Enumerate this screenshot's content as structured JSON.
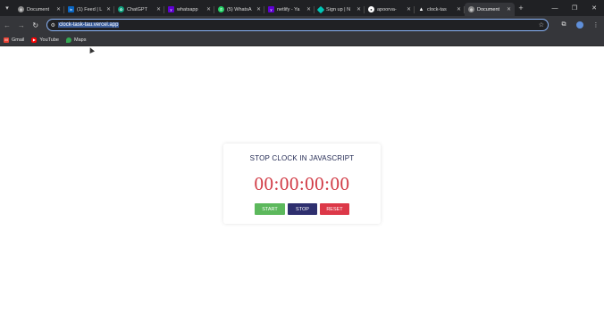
{
  "browser": {
    "tabs": [
      {
        "title": "Document",
        "icon": "globe-icon",
        "color": "#8a8a8a"
      },
      {
        "title": "(1) Feed | L",
        "icon": "linkedin-icon",
        "color": "#0a66c2"
      },
      {
        "title": "ChatGPT",
        "icon": "chatgpt-icon",
        "color": "#10a37f"
      },
      {
        "title": "whatsapp",
        "icon": "yahoo-icon",
        "color": "#6001d2"
      },
      {
        "title": "(5) WhatsA",
        "icon": "whatsapp-icon",
        "color": "#25d366"
      },
      {
        "title": "netlify - Ya",
        "icon": "yahoo-icon",
        "color": "#6001d2"
      },
      {
        "title": "Sign up | N",
        "icon": "netlify-icon",
        "color": "#00c7b7"
      },
      {
        "title": "apoorva-",
        "icon": "github-icon",
        "color": "#ffffff"
      },
      {
        "title": "clock-tas",
        "icon": "vercel-icon",
        "color": "#ffffff"
      },
      {
        "title": "Document",
        "icon": "globe-icon",
        "color": "#8a8a8a",
        "active": true
      }
    ],
    "url": "clock-task-tau.vercel.app",
    "bookmarks": [
      {
        "label": "Gmail",
        "icon": "gmail-icon"
      },
      {
        "label": "YouTube",
        "icon": "youtube-icon"
      },
      {
        "label": "Maps",
        "icon": "maps-icon"
      }
    ]
  },
  "page": {
    "title": "STOP CLOCK IN JAVASCRIPT",
    "clock": "00:00:00:00",
    "buttons": {
      "start": "START",
      "stop": "STOP",
      "reset": "RESET"
    },
    "colors": {
      "title": "#1f2650",
      "clock": "#d13a45",
      "start": "#5cb85c",
      "stop": "#2e2f6e",
      "reset": "#dc3848"
    }
  }
}
